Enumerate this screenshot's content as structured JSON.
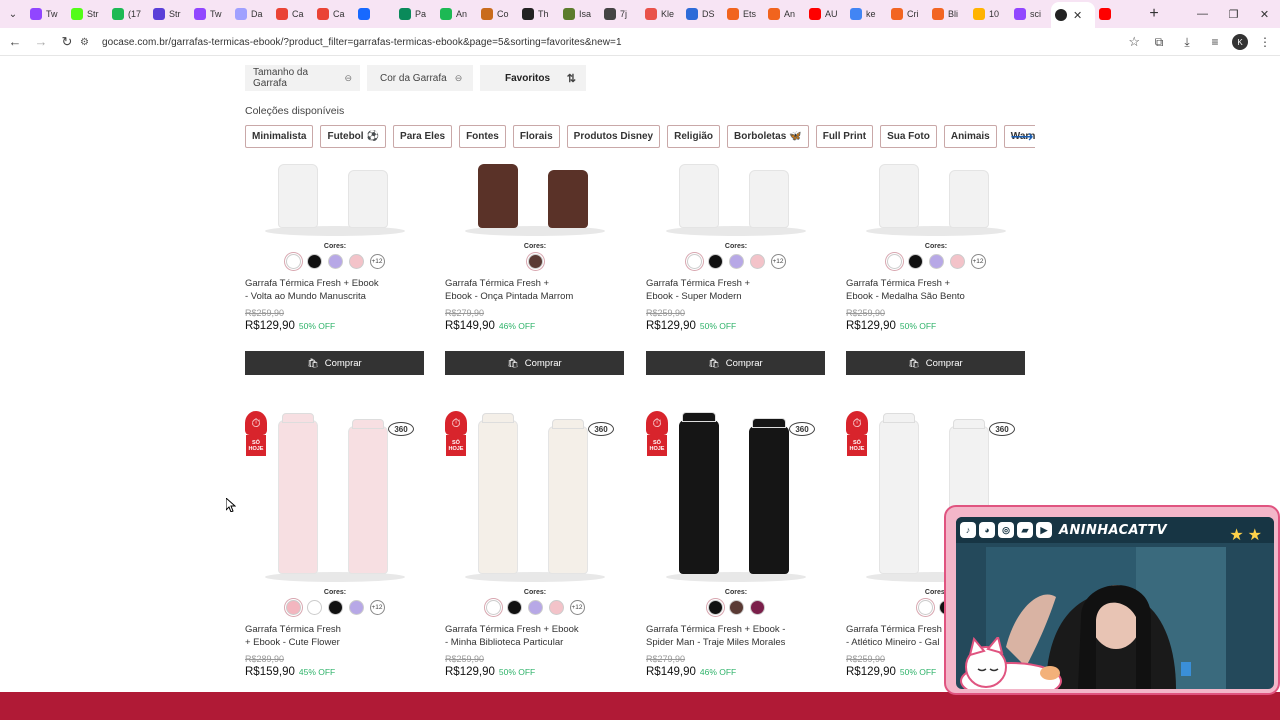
{
  "browser": {
    "tabs": [
      {
        "label": "Tw",
        "color": "#9146ff"
      },
      {
        "label": "Str",
        "color": "#53fc18"
      },
      {
        "label": "(17",
        "color": "#1db954"
      },
      {
        "label": "Str",
        "color": "#5a3fd8"
      },
      {
        "label": "Tw",
        "color": "#9146ff"
      },
      {
        "label": "Da",
        "color": "#a0a0ff"
      },
      {
        "label": "Ca",
        "color": "#ea4335"
      },
      {
        "label": "Ca",
        "color": "#ea4335"
      },
      {
        "label": "",
        "color": "#1769ff"
      },
      {
        "label": "Pa",
        "color": "#0a8a5a"
      },
      {
        "label": "An",
        "color": "#1db954"
      },
      {
        "label": "Co",
        "color": "#c96b1c"
      },
      {
        "label": "Th",
        "color": "#222222"
      },
      {
        "label": "Isa",
        "color": "#5c7c2c"
      },
      {
        "label": "7j",
        "color": "#444444"
      },
      {
        "label": "Kle",
        "color": "#e9524a"
      },
      {
        "label": "DS",
        "color": "#2e6bd8"
      },
      {
        "label": "Ets",
        "color": "#f1641e"
      },
      {
        "label": "An",
        "color": "#f1641e"
      },
      {
        "label": "AU",
        "color": "#ff0000"
      },
      {
        "label": "ke",
        "color": "#4285f4"
      },
      {
        "label": "Cri",
        "color": "#f26522"
      },
      {
        "label": "Bli",
        "color": "#f26522"
      },
      {
        "label": "10",
        "color": "#ffb300"
      },
      {
        "label": "sci",
        "color": "#9146ff"
      },
      {
        "label": "",
        "color": "#ff0000"
      }
    ],
    "active_tab_close": "✕",
    "new_tab": "+",
    "url": "gocase.com.br/garrafas-termicas-ebook/?product_filter=garrafas-termicas-ebook&page=5&sorting=favorites&new=1"
  },
  "filters": {
    "size": "Tamanho da Garrafa",
    "color": "Cor da Garrafa",
    "sort": "Favoritos"
  },
  "collections": {
    "title": "Coleções disponíveis",
    "chips": [
      {
        "label": "Minimalista",
        "icon": ""
      },
      {
        "label": "Futebol",
        "icon": "⚽"
      },
      {
        "label": "Para Eles",
        "icon": ""
      },
      {
        "label": "Fontes",
        "icon": ""
      },
      {
        "label": "Florais",
        "icon": ""
      },
      {
        "label": "Produtos Disney",
        "icon": ""
      },
      {
        "label": "Religião",
        "icon": ""
      },
      {
        "label": "Borboletas",
        "icon": "🦋"
      },
      {
        "label": "Full Print",
        "icon": ""
      },
      {
        "label": "Sua Foto",
        "icon": ""
      },
      {
        "label": "Animais",
        "icon": ""
      },
      {
        "label": "Warner",
        "icon": ""
      }
    ]
  },
  "row1": [
    {
      "name_l1": "Garrafa Térmica Fresh + Ebook",
      "name_l2": "- Volta ao Mundo Manuscrita",
      "old": "R$259,90",
      "price": "R$129,90",
      "off": "50% OFF",
      "bottle": "#f2f2f2",
      "swatches": [
        "#ffffff",
        "#111111",
        "#b7a8e6",
        "#f3c3c9"
      ],
      "more": "+12"
    },
    {
      "name_l1": "Garrafa Térmica Fresh +",
      "name_l2": "Ebook - Onça Pintada Marrom",
      "old": "R$279,90",
      "price": "R$149,90",
      "off": "46% OFF",
      "bottle": "#5a3228",
      "swatches": [
        "#5a3a34"
      ],
      "more": ""
    },
    {
      "name_l1": "Garrafa Térmica Fresh +",
      "name_l2": "Ebook - Super Modern",
      "old": "R$259,90",
      "price": "R$129,90",
      "off": "50% OFF",
      "bottle": "#f2f2f2",
      "swatches": [
        "#ffffff",
        "#111111",
        "#b7a8e6",
        "#f3c3c9"
      ],
      "more": "+12"
    },
    {
      "name_l1": "Garrafa Térmica Fresh +",
      "name_l2": "Ebook - Medalha São Bento",
      "old": "R$259,90",
      "price": "R$129,90",
      "off": "50% OFF",
      "bottle": "#f2f2f2",
      "swatches": [
        "#ffffff",
        "#111111",
        "#b7a8e6",
        "#f3c3c9"
      ],
      "more": "+12"
    }
  ],
  "row2": [
    {
      "name_l1": "Garrafa Térmica Fresh",
      "name_l2": "+ Ebook - Cute Flower",
      "old": "R$289,90",
      "price": "R$159,90",
      "off": "45% OFF",
      "bottle": "#f7dfe2",
      "swatches": [
        "#f3b6bf",
        "#ffffff",
        "#111111",
        "#b7a8e6"
      ],
      "more": "+12"
    },
    {
      "name_l1": "Garrafa Térmica Fresh + Ebook",
      "name_l2": "- Minha Biblioteca Particular",
      "old": "R$259,90",
      "price": "R$129,90",
      "off": "50% OFF",
      "bottle": "#f4efe8",
      "swatches": [
        "#ffffff",
        "#111111",
        "#b7a8e6",
        "#f3c3c9"
      ],
      "more": "+12"
    },
    {
      "name_l1": "Garrafa Térmica Fresh + Ebook -",
      "name_l2": "Spider Man - Traje Miles Morales",
      "old": "R$279,90",
      "price": "R$149,90",
      "off": "46% OFF",
      "bottle": "#151515",
      "swatches": [
        "#111111",
        "#5a3a34",
        "#7a1f4a"
      ],
      "more": ""
    },
    {
      "name_l1": "Garrafa Térmica Fresh +",
      "name_l2": "- Atlético Mineiro - Gal",
      "old": "R$259,90",
      "price": "R$129,90",
      "off": "50% OFF",
      "bottle": "#f2f2f2",
      "swatches": [
        "#ffffff",
        "#111111"
      ],
      "more": ""
    }
  ],
  "labels": {
    "cores": "Cores:",
    "buy": "Comprar",
    "badge_360": "360",
    "so_hoje": "SÓ HOJE"
  },
  "stream": {
    "name": "ANINHACATTV",
    "border_color": "#e05480"
  }
}
